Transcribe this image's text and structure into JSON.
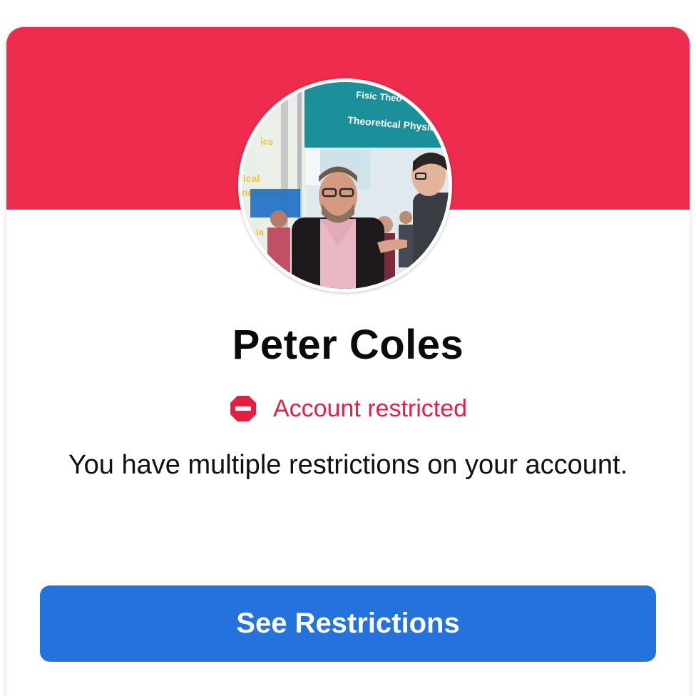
{
  "profile": {
    "name": "Peter Coles",
    "avatar_signage": [
      "Fisic Theo",
      "Theoretical Physics"
    ],
    "avatar_side_text": [
      "ics",
      "ical",
      "noothuni",
      "ia"
    ]
  },
  "status": {
    "icon": "restricted-icon",
    "label": "Account restricted",
    "color": "#e41e45"
  },
  "message": "You have multiple restrictions on your account.",
  "actions": {
    "see_restrictions": "See Restrictions"
  },
  "colors": {
    "banner": "#ee2c4d",
    "button": "#2372de"
  }
}
